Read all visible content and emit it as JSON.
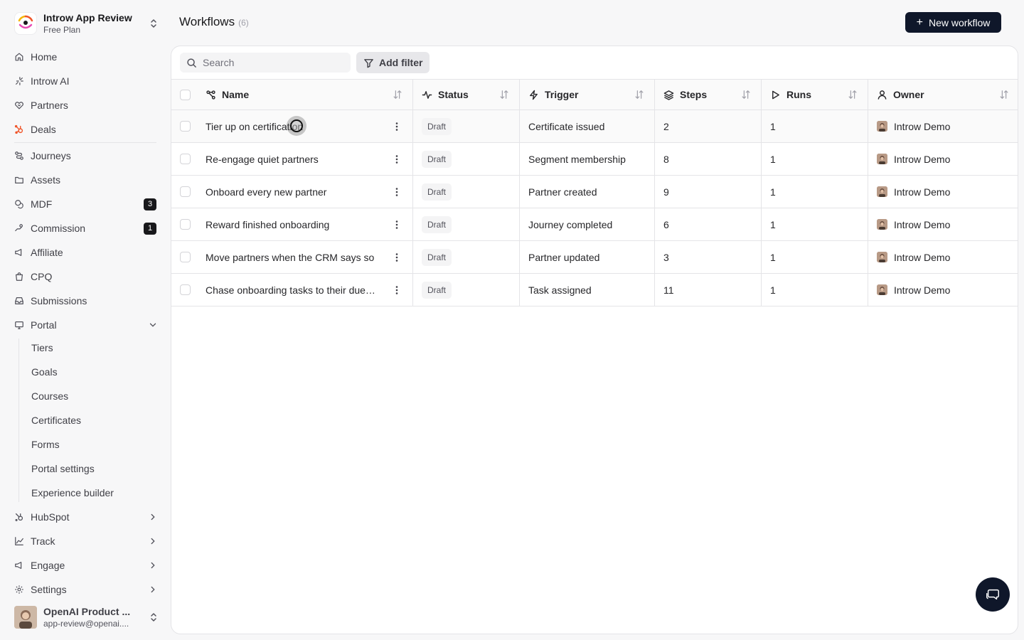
{
  "org": {
    "name": "Introw App Review",
    "plan": "Free Plan"
  },
  "nav": {
    "home": "Home",
    "ai": "Introw AI",
    "partners": "Partners",
    "deals": "Deals",
    "journeys": "Journeys",
    "assets": "Assets",
    "mdf": "MDF",
    "mdf_badge": "3",
    "commission": "Commission",
    "commission_badge": "1",
    "affiliate": "Affiliate",
    "cpq": "CPQ",
    "submissions": "Submissions",
    "portal": "Portal",
    "portal_sub": [
      "Tiers",
      "Goals",
      "Courses",
      "Certificates",
      "Forms",
      "Portal settings",
      "Experience builder"
    ],
    "hubspot": "HubSpot",
    "track": "Track",
    "engage": "Engage",
    "settings": "Settings"
  },
  "user": {
    "name": "OpenAI Product ...",
    "email": "app-review@openai...."
  },
  "page": {
    "title": "Workflows",
    "count": "(6)",
    "new_button": "New workflow"
  },
  "toolbar": {
    "search_placeholder": "Search",
    "filter_label": "Add filter"
  },
  "table": {
    "columns": {
      "name": "Name",
      "status": "Status",
      "trigger": "Trigger",
      "steps": "Steps",
      "runs": "Runs",
      "owner": "Owner"
    },
    "rows": [
      {
        "name": "Tier up on certification",
        "status": "Draft",
        "trigger": "Certificate issued",
        "steps": "2",
        "runs": "1",
        "owner": "Introw Demo"
      },
      {
        "name": "Re-engage quiet partners",
        "status": "Draft",
        "trigger": "Segment membership",
        "steps": "8",
        "runs": "1",
        "owner": "Introw Demo"
      },
      {
        "name": "Onboard every new partner",
        "status": "Draft",
        "trigger": "Partner created",
        "steps": "9",
        "runs": "1",
        "owner": "Introw Demo"
      },
      {
        "name": "Reward finished onboarding",
        "status": "Draft",
        "trigger": "Journey completed",
        "steps": "6",
        "runs": "1",
        "owner": "Introw Demo"
      },
      {
        "name": "Move partners when the CRM says so",
        "status": "Draft",
        "trigger": "Partner updated",
        "steps": "3",
        "runs": "1",
        "owner": "Introw Demo"
      },
      {
        "name": "Chase onboarding tasks to their due…",
        "status": "Draft",
        "trigger": "Task assigned",
        "steps": "11",
        "runs": "1",
        "owner": "Introw Demo"
      }
    ]
  },
  "colors": {
    "primary": "#0f172a",
    "deals_icon": "#f0562b"
  }
}
